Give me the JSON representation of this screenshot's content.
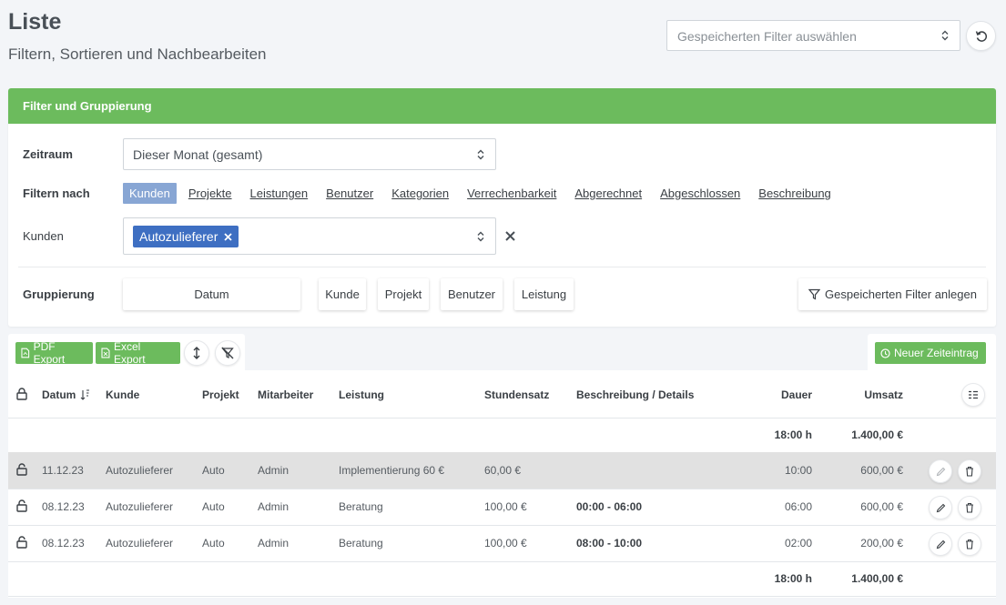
{
  "page": {
    "title": "Liste",
    "subtitle": "Filtern, Sortieren und Nachbearbeiten"
  },
  "saved_filter": {
    "placeholder": "Gespeicherten Filter auswählen"
  },
  "filter_card": {
    "header": "Filter und Gruppierung",
    "zeitraum_label": "Zeitraum",
    "zeitraum_value": "Dieser Monat (gesamt)",
    "filter_by_label": "Filtern nach",
    "filter_tabs": [
      "Kunden",
      "Projekte",
      "Leistungen",
      "Benutzer",
      "Kategorien",
      "Verrechenbarkeit",
      "Abgerechnet",
      "Abgeschlossen",
      "Beschreibung"
    ],
    "active_filter_tab": "Kunden",
    "kunden_label": "Kunden",
    "kunden_selected": "Autozulieferer",
    "grouping_label": "Gruppierung",
    "grouping_options": [
      "Datum",
      "Kunde",
      "Projekt",
      "Benutzer",
      "Leistung"
    ],
    "save_filter_button": "Gespeicherten Filter anlegen"
  },
  "toolbar": {
    "pdf_export": "PDF Export",
    "excel_export": "Excel Export",
    "new_entry": "Neuer Zeiteintrag"
  },
  "table": {
    "columns": [
      "Datum",
      "Kunde",
      "Projekt",
      "Mitarbeiter",
      "Leistung",
      "Stundensatz",
      "Beschreibung / Details",
      "Dauer",
      "Umsatz"
    ],
    "top_total": {
      "dauer": "18:00 h",
      "umsatz": "1.400,00 €"
    },
    "rows": [
      {
        "datum": "11.12.23",
        "kunde": "Autozulieferer",
        "projekt": "Auto",
        "mitarbeiter": "Admin",
        "leistung": "Implementierung 60 €",
        "stundensatz": "60,00 €",
        "beschreibung": "",
        "dauer": "10:00",
        "umsatz": "600,00 €"
      },
      {
        "datum": "08.12.23",
        "kunde": "Autozulieferer",
        "projekt": "Auto",
        "mitarbeiter": "Admin",
        "leistung": "Beratung",
        "stundensatz": "100,00 €",
        "beschreibung": "00:00 - 06:00",
        "dauer": "06:00",
        "umsatz": "600,00 €"
      },
      {
        "datum": "08.12.23",
        "kunde": "Autozulieferer",
        "projekt": "Auto",
        "mitarbeiter": "Admin",
        "leistung": "Beratung",
        "stundensatz": "100,00 €",
        "beschreibung": "08:00 - 10:00",
        "dauer": "02:00",
        "umsatz": "200,00 €"
      }
    ],
    "bottom_total": {
      "dauer": "18:00 h",
      "umsatz": "1.400,00 €"
    }
  },
  "colors": {
    "accent_green": "#6cbb5d",
    "chip_blue": "#3e6fc2",
    "active_tab": "#88a6d4"
  }
}
